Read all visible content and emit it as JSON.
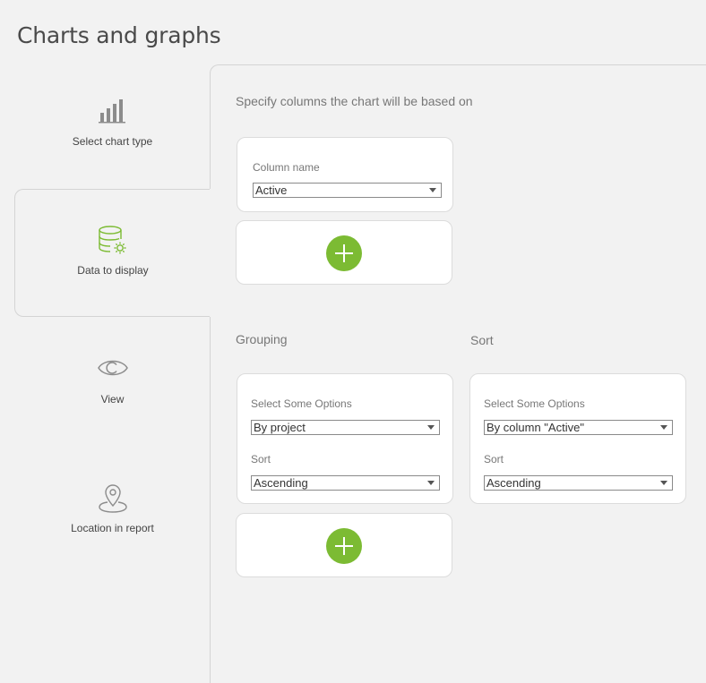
{
  "page": {
    "title": "Charts and graphs"
  },
  "sidebar": {
    "steps": [
      {
        "label": "Select chart type",
        "icon": "bar-chart-icon"
      },
      {
        "label": "Data to display",
        "icon": "database-settings-icon",
        "active": true
      },
      {
        "label": "View",
        "icon": "eye-icon"
      },
      {
        "label": "Location in report",
        "icon": "location-pin-icon"
      }
    ]
  },
  "main": {
    "instruction": "Specify columns the chart will be based on",
    "column_card": {
      "label": "Column name",
      "value": "Active"
    },
    "grouping": {
      "heading": "Grouping",
      "options_label": "Select Some Options",
      "options_value": "By project",
      "sort_label": "Sort",
      "sort_value": "Ascending"
    },
    "sort": {
      "heading": "Sort",
      "options_label": "Select Some Options",
      "options_value": "By column \"Active\"",
      "sort_label": "Sort",
      "sort_value": "Ascending"
    }
  },
  "colors": {
    "accent": "#7cbb33",
    "background": "#f2f2f2",
    "card": "#ffffff"
  }
}
